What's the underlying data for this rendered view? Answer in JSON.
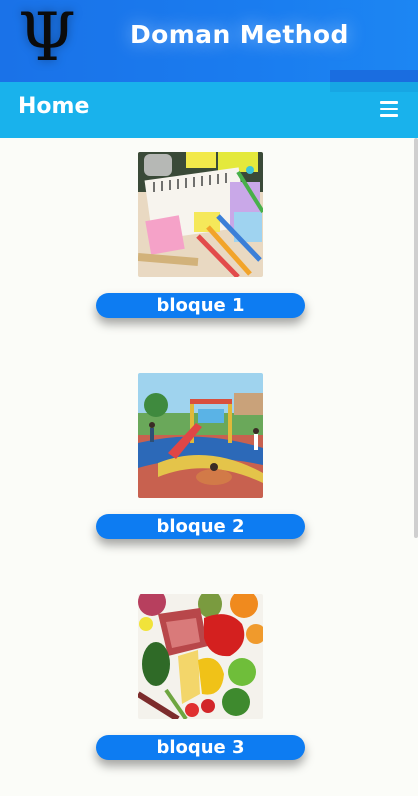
{
  "header": {
    "logo_glyph": "Ψ",
    "title": "Doman Method",
    "colors": {
      "header_bg": "#1a72e8",
      "nav_bg": "#19b2ec",
      "button_bg": "#0d7cf2",
      "page_bg": "#fbfcf8"
    }
  },
  "nav": {
    "page_title": "Home",
    "menu_icon": "hamburger-menu-icon"
  },
  "blocks": [
    {
      "label": "bloque 1",
      "image": "school-supplies-image"
    },
    {
      "label": "bloque 2",
      "image": "playground-image"
    },
    {
      "label": "bloque 3",
      "image": "fruits-vegetables-image"
    }
  ]
}
